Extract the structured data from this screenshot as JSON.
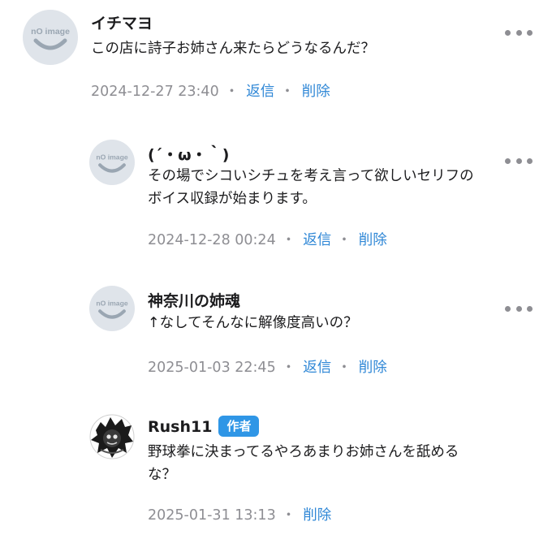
{
  "comments": [
    {
      "author": "イチマヨ",
      "avatar_icon": "no-image-avatar",
      "text": "この店に詩子お姉さん来たらどうなるんだ？",
      "timestamp": "2024-12-27 23:40",
      "separator": "・",
      "reply_label": "返信",
      "delete_label": "削除",
      "more_icon": "more-icon"
    },
    {
      "author": "(´・ω・｀)",
      "avatar_icon": "no-image-avatar",
      "text": "その場でシコいシチュを考え言って欲しいセリフのボイス収録が始まります。",
      "timestamp": "2024-12-28 00:24",
      "separator": "・",
      "reply_label": "返信",
      "delete_label": "削除",
      "more_icon": "more-icon"
    },
    {
      "author": "神奈川の姉魂",
      "avatar_icon": "no-image-avatar",
      "text": "↑なしてそんなに解像度高いの？",
      "timestamp": "2025-01-03 22:45",
      "separator": "・",
      "reply_label": "返信",
      "delete_label": "削除",
      "more_icon": "more-icon"
    },
    {
      "author": "Rush11",
      "badge": "作者",
      "avatar_icon": "author-avatar",
      "text": "野球拳に決まってるやろあまりお姉さんを舐めるな？",
      "timestamp": "2025-01-31 13:13",
      "separator": "・",
      "delete_label": "削除"
    }
  ],
  "avatar_placeholder_text": "nO image",
  "colors": {
    "link": "#2f87d6",
    "meta": "#8e8e93",
    "badge": "#2f96e6",
    "avatar_bg": "#dfe4ea"
  }
}
